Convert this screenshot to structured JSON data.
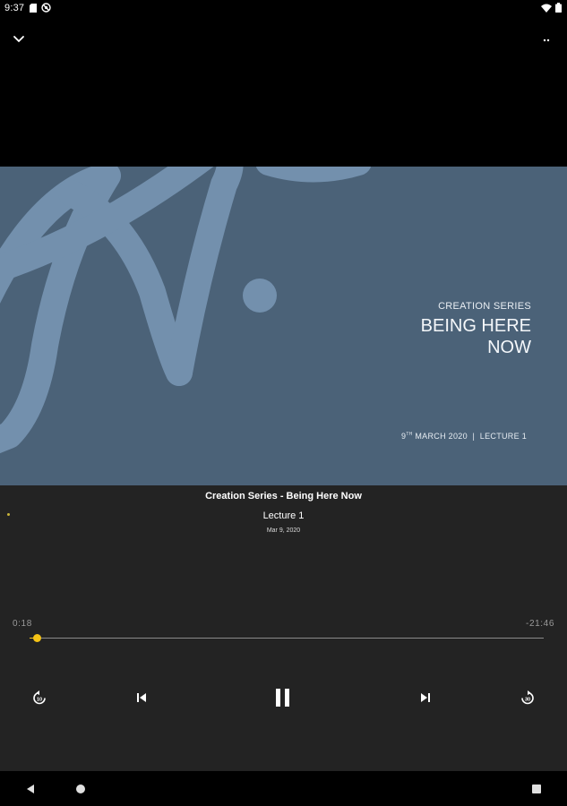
{
  "status_bar": {
    "time": "9:37",
    "left_icons": [
      "sd-card-icon",
      "signal-off-icon"
    ],
    "right_icons": [
      "wifi-icon",
      "battery-icon"
    ]
  },
  "header": {
    "collapse_icon": "chevron-down-icon",
    "more_icon": "more-icon"
  },
  "artwork": {
    "series_label": "CREATION SERIES",
    "title_line1": "BEING HERE",
    "title_line2": "NOW",
    "date_day": "9",
    "date_suffix": "TH",
    "date_rest": " MARCH 2020",
    "lecture_label": "LECTURE 1",
    "colors": {
      "background": "#4b6278",
      "stroke": "#7390ad"
    }
  },
  "player": {
    "episode_title": "Creation Series - Being Here Now",
    "lecture_name": "Lecture 1",
    "lecture_date": "Mar 9, 2020",
    "elapsed": "0:18",
    "remaining": "-21:46",
    "progress_fraction": 0.014,
    "colors": {
      "accent": "#f5c316",
      "panel": "#232323"
    },
    "controls": [
      "rewind-icon",
      "skip-previous-icon",
      "pause-icon",
      "skip-next-icon",
      "forward-icon"
    ]
  },
  "nav_bar": {
    "buttons": [
      "back-icon",
      "home-icon",
      "recents-icon"
    ]
  }
}
